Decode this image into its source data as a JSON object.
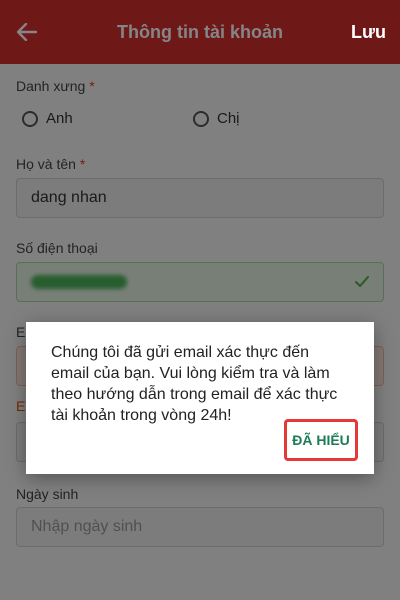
{
  "header": {
    "title": "Thông tin tài khoản",
    "save_label": "Lưu",
    "back_icon": "arrow-left-icon"
  },
  "form": {
    "salutation_label": "Danh xưng",
    "required_mark": "*",
    "options": [
      {
        "label": "Anh",
        "selected": false
      },
      {
        "label": "Chị",
        "selected": false
      }
    ],
    "fullname_label": "Họ và tên",
    "fullname_value": "dang nhan",
    "phone_label": "Số điện thoại",
    "phone_status_icon": "check-icon",
    "email_label_partial": "E",
    "email_hint_partial": "E",
    "birthday_label": "Ngày sinh",
    "birthday_placeholder": "Nhập ngày sinh"
  },
  "dialog": {
    "message": "Chúng tôi đã gửi email xác thực đến email của bạn. Vui lòng kiểm tra và làm theo hướng dẫn trong email để xác thực tài khoản trong vòng 24h!",
    "confirm_label": "ĐÃ HIỂU"
  },
  "colors": {
    "header": "#d32f2f",
    "accent_green": "#1e7b57",
    "highlight_red": "#e53935"
  }
}
